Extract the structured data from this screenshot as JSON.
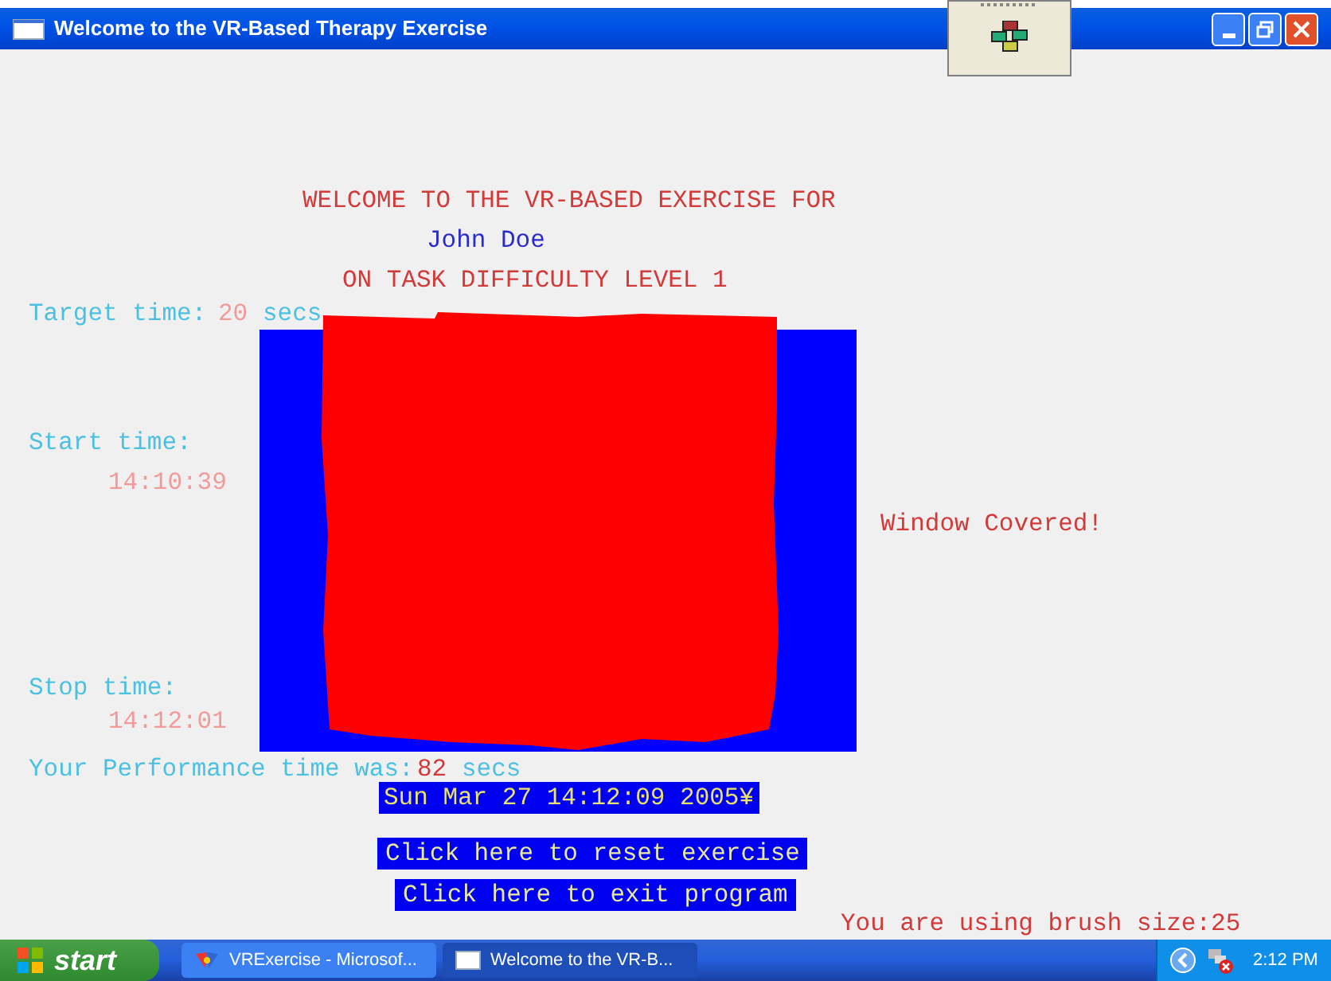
{
  "window": {
    "title": "Welcome to the VR-Based Therapy Exercise"
  },
  "header": {
    "welcome": "WELCOME TO THE VR-BASED EXERCISE FOR",
    "patient": "John Doe",
    "level": "ON TASK DIFFICULTY LEVEL 1"
  },
  "target_time": {
    "label": "Target time:",
    "value": "20",
    "unit": "secs"
  },
  "start_time": {
    "label": "Start time:",
    "value": "14:10:39"
  },
  "stop_time": {
    "label": "Stop time:",
    "value": "14:12:01"
  },
  "performance": {
    "label": "Your Performance time was:",
    "value": "82",
    "unit": "secs"
  },
  "date": "Sun Mar 27 14:12:09 2005¥",
  "buttons": [
    "Click here to reset exercise",
    "Click here to exit program"
  ],
  "status": "Window Covered!",
  "brush": "You are using brush size:25",
  "taskbar": {
    "start": "start",
    "tasks": [
      {
        "label": "VRExercise - Microsof...",
        "selected": false
      },
      {
        "label": "Welcome to the VR-B...",
        "selected": true
      }
    ],
    "clock": "2:12 PM"
  }
}
